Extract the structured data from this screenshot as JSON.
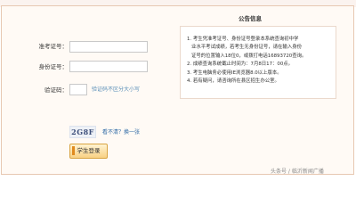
{
  "form": {
    "exam_id_label": "准考证号：",
    "id_card_label": "身份证号：",
    "captcha_label": "验证码：",
    "captcha_hint": "验证码不区分大小写",
    "captcha_value": "2G8F",
    "refresh_link": "看不清？换一张",
    "login_button": "学生登录"
  },
  "notice": {
    "title": "公告信息",
    "items": [
      "1. 考生凭准考证号、身份证号登录本系统查询初中学",
      "业水平考试成绩，若考生无身份证号，请在输入身份",
      "证号的位置输入18位0，或拨打电话16893720查询。",
      "2. 成绩查询系统截止时间为：7月8日17：00点。",
      "3. 考生电脑务必使用IE浏览器8.0以上版本。",
      "4. 若有疑问，请咨询所在县区招生办公室。"
    ]
  },
  "watermark": "头条号 / 临沂新闻广播"
}
